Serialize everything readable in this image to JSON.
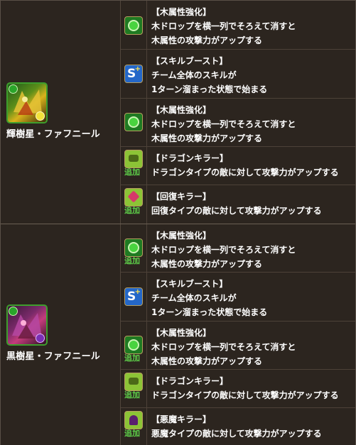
{
  "colors": {
    "green_plus": "#5fd24a",
    "wood_badge": "#34c13b",
    "skill_boost": "#2f7fe8",
    "killer_badge": "#9bcf3c"
  },
  "monsters": [
    {
      "name": "輝樹星・ファフニール",
      "attr_icon": "wood-attribute-icon",
      "sub_icon": "light-attribute-icon",
      "awakenings": [
        {
          "icon": "wood-row-enhance-icon",
          "title": "【木属性強化】",
          "text": "木ドロップを横一列でそろえて消すと\n木属性の攻撃力がアップする",
          "added": ""
        },
        {
          "icon": "skill-boost-icon",
          "title": "【スキルブースト】",
          "text": "チーム全体のスキルが\n1ターン溜まった状態で始まる",
          "added": ""
        },
        {
          "icon": "wood-row-enhance-icon",
          "title": "【木属性強化】",
          "text": "木ドロップを横一列でそろえて消すと\n木属性の攻撃力がアップする",
          "added": ""
        },
        {
          "icon": "dragon-killer-icon",
          "title": "【ドラゴンキラー】",
          "text": "ドラゴンタイプの敵に対して攻撃力がアップする",
          "added": "追加"
        },
        {
          "icon": "healer-killer-icon",
          "title": "【回復キラー】",
          "text": "回復タイプの敵に対して攻撃力がアップする",
          "added": "追加"
        }
      ]
    },
    {
      "name": "黒樹星・ファフニール",
      "attr_icon": "wood-attribute-icon",
      "sub_icon": "dark-attribute-icon",
      "awakenings": [
        {
          "icon": "wood-row-enhance-icon",
          "title": "【木属性強化】",
          "text": "木ドロップを横一列でそろえて消すと\n木属性の攻撃力がアップする",
          "added": "追加"
        },
        {
          "icon": "skill-boost-icon",
          "title": "【スキルブースト】",
          "text": "チーム全体のスキルが\n1ターン溜まった状態で始まる",
          "added": ""
        },
        {
          "icon": "wood-row-enhance-icon",
          "title": "【木属性強化】",
          "text": "木ドロップを横一列でそろえて消すと\n木属性の攻撃力がアップする",
          "added": "追加"
        },
        {
          "icon": "dragon-killer-icon",
          "title": "【ドラゴンキラー】",
          "text": "ドラゴンタイプの敵に対して攻撃力がアップする",
          "added": "追加"
        },
        {
          "icon": "devil-killer-icon",
          "title": "【悪魔キラー】",
          "text": "悪魔タイプの敵に対して攻撃力がアップする",
          "added": "追加"
        }
      ]
    }
  ]
}
